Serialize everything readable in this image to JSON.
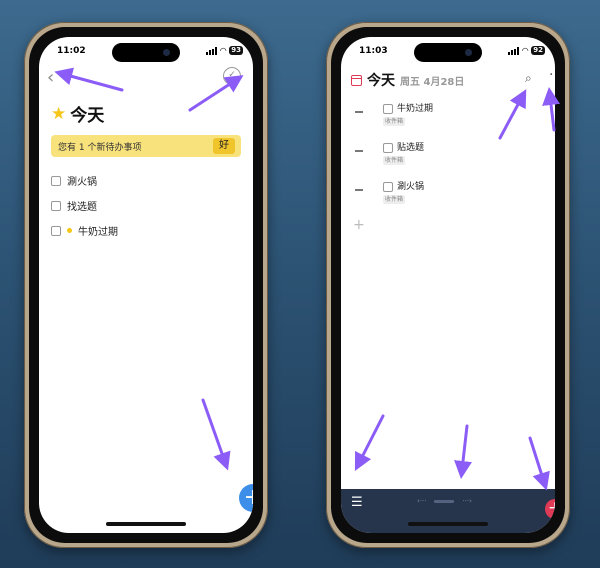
{
  "left_phone": {
    "status": {
      "time": "11:02",
      "battery": "93"
    },
    "title": "今天",
    "banner": {
      "message": "您有 1 个新待办事项",
      "button": "好"
    },
    "tasks": [
      {
        "label": "涮火锅",
        "dot": false
      },
      {
        "label": "找选题",
        "dot": false
      },
      {
        "label": "牛奶过期",
        "dot": true
      }
    ]
  },
  "right_phone": {
    "status": {
      "time": "11:03",
      "battery": "92"
    },
    "title": "今天",
    "date": "周五 4月28日",
    "tasks": [
      {
        "label": "牛奶过期",
        "tag": "收件箱"
      },
      {
        "label": "贴选题",
        "tag": "收件箱"
      },
      {
        "label": "涮火锅",
        "tag": "收件箱"
      }
    ],
    "pager_prev": "‹···",
    "pager_next": "···›"
  },
  "icons": {
    "back": "chevron-left-icon",
    "complete": "check-circle-icon",
    "star": "star-icon",
    "add": "plus-icon",
    "search": "search-icon",
    "more": "more-icon",
    "menu": "menu-icon",
    "calendar": "calendar-icon"
  },
  "colors": {
    "background": "#2d5475",
    "phone_frame": "#b9a78c",
    "banner": "#f8e27c",
    "banner_button": "#f0c52b",
    "fab_blue": "#3d8ee8",
    "fab_red": "#e03b56",
    "bottom_bar": "#26354c",
    "arrow": "#8b5cf6"
  }
}
